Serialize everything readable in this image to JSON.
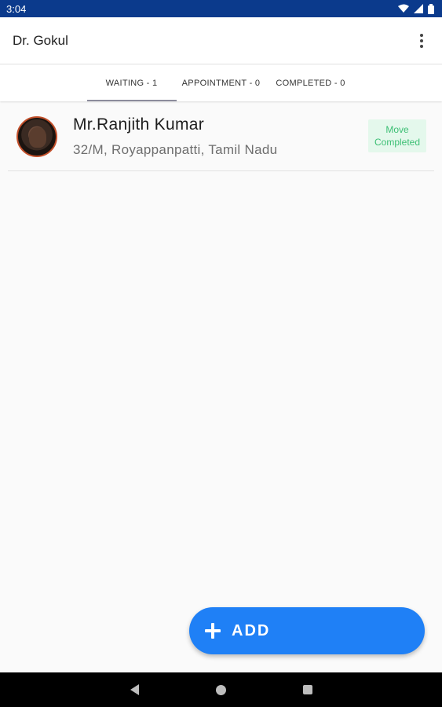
{
  "status_bar": {
    "time": "3:04"
  },
  "app_bar": {
    "title": "Dr. Gokul"
  },
  "tabs": [
    {
      "label": "WAITING - 1",
      "active": true
    },
    {
      "label": "APPOINTMENT - 0",
      "active": false
    },
    {
      "label": "COMPLETED - 0",
      "active": false
    }
  ],
  "patients": [
    {
      "name": "Mr.Ranjith Kumar",
      "details": "32/M, Royappanpatti, Tamil Nadu",
      "action_label": "Move Completed"
    }
  ],
  "fab": {
    "label": "ADD"
  },
  "colors": {
    "status_bar": "#0b3a8c",
    "fab": "#1f80f6",
    "move_button_bg": "#e4f8ec",
    "move_button_text": "#3cbf74"
  },
  "icons": [
    "wifi-icon",
    "signal-icon",
    "battery-icon",
    "more-vert-icon",
    "plus-icon",
    "nav-back-icon",
    "nav-home-icon",
    "nav-recent-icon"
  ]
}
